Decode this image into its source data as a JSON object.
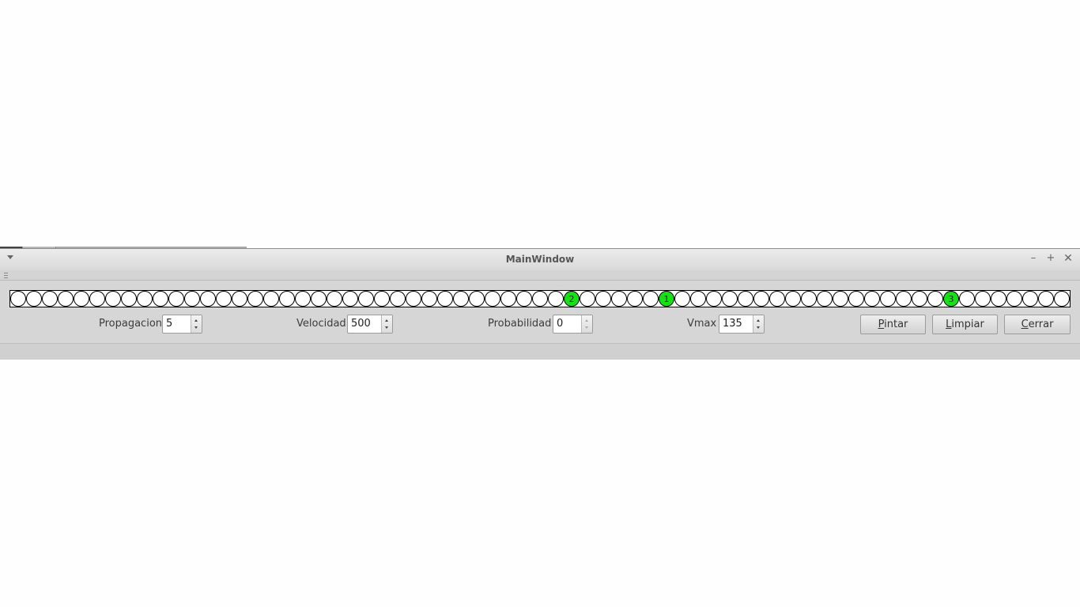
{
  "window": {
    "title": "MainWindow"
  },
  "cells": {
    "count": 67,
    "empty_color": "#ffffff",
    "active_color": "#16e016",
    "active": [
      {
        "index": 35,
        "label": "2"
      },
      {
        "index": 41,
        "label": "1"
      },
      {
        "index": 59,
        "label": "3"
      }
    ]
  },
  "controls": {
    "propagacion": {
      "label": "Propagacion",
      "value": "5"
    },
    "velocidad": {
      "label": "Velocidad",
      "value": "500"
    },
    "probabilidad": {
      "label": "Probabilidad",
      "value": "0"
    },
    "vmax": {
      "label": "Vmax",
      "value": "135"
    }
  },
  "buttons": {
    "pintar": {
      "mnemonic": "P",
      "rest": "intar"
    },
    "limpiar": {
      "mnemonic": "L",
      "rest": "impiar"
    },
    "cerrar": {
      "mnemonic": "C",
      "rest": "errar"
    }
  },
  "icons": {
    "menu": "chevron-down-icon",
    "minimize": "minimize-icon",
    "maximize": "maximize-icon",
    "close": "close-icon"
  }
}
